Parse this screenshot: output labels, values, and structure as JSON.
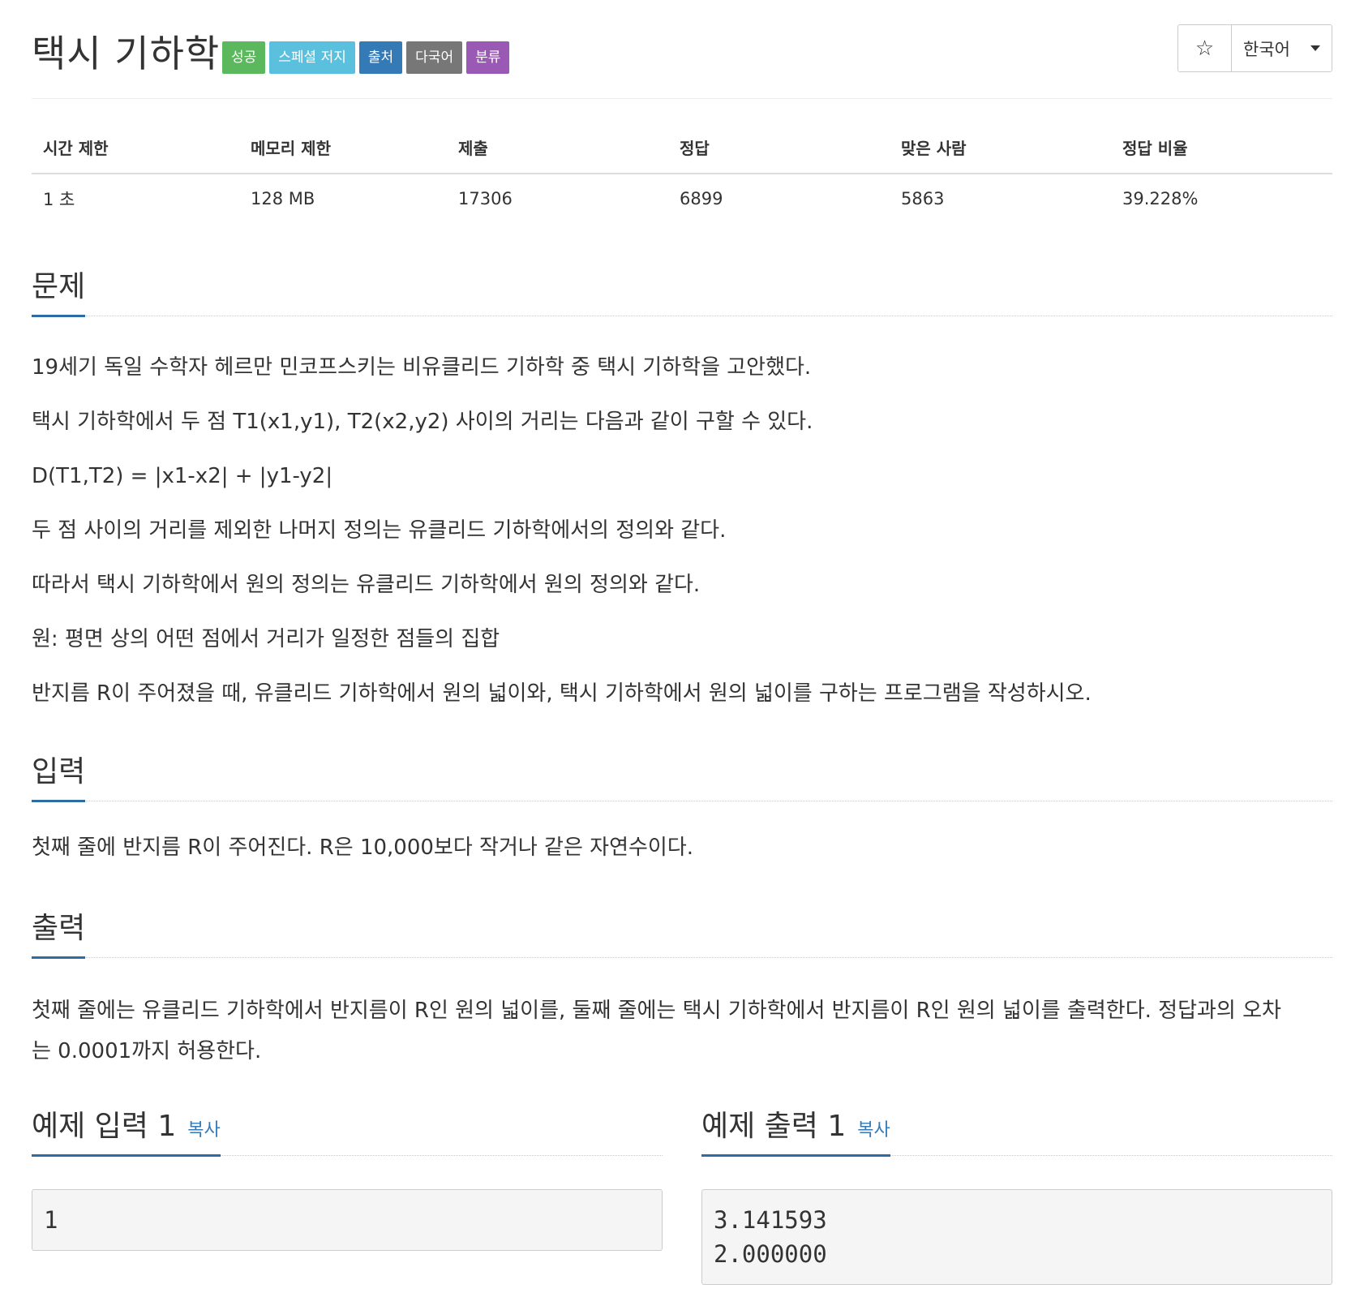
{
  "header": {
    "title": "택시 기하학",
    "labels": [
      {
        "text": "성공",
        "color": "#5cb85c"
      },
      {
        "text": "스페셜 저지",
        "color": "#5bc0de"
      },
      {
        "text": "출처",
        "color": "#337ab7"
      },
      {
        "text": "다국어",
        "color": "#777777"
      },
      {
        "text": "분류",
        "color": "#9b59b6"
      }
    ],
    "star": "☆",
    "language": "한국어"
  },
  "stats": {
    "headers": [
      "시간 제한",
      "메모리 제한",
      "제출",
      "정답",
      "맞은 사람",
      "정답 비율"
    ],
    "values": [
      "1 초",
      "128 MB",
      "17306",
      "6899",
      "5863",
      "39.228%"
    ]
  },
  "problem": {
    "title": "문제",
    "paragraphs": [
      "19세기 독일 수학자 헤르만 민코프스키는 비유클리드 기하학 중 택시 기하학을 고안했다.",
      "택시 기하학에서 두 점 T1(x1,y1), T2(x2,y2) 사이의 거리는 다음과 같이 구할 수 있다.",
      "D(T1,T2) = |x1-x2| + |y1-y2|",
      "두 점 사이의 거리를 제외한 나머지 정의는 유클리드 기하학에서의 정의와 같다.",
      "따라서 택시 기하학에서 원의 정의는 유클리드 기하학에서 원의 정의와 같다.",
      "원: 평면 상의 어떤 점에서 거리가 일정한 점들의 집합",
      "반지름 R이 주어졌을 때, 유클리드 기하학에서 원의 넓이와, 택시 기하학에서 원의 넓이를 구하는 프로그램을 작성하시오."
    ]
  },
  "input": {
    "title": "입력",
    "text": "첫째 줄에 반지름 R이 주어진다. R은 10,000보다 작거나 같은 자연수이다."
  },
  "output": {
    "title": "출력",
    "text": "첫째 줄에는 유클리드 기하학에서 반지름이 R인 원의 넓이를, 둘째 줄에는 택시 기하학에서 반지름이 R인 원의 넓이를 출력한다. 정답과의 오차는 0.0001까지 허용한다."
  },
  "samples": {
    "input_title": "예제 입력 1",
    "output_title": "예제 출력 1",
    "copy_label": "복사",
    "input_value": "1",
    "output_value": "3.141593\n2.000000"
  }
}
